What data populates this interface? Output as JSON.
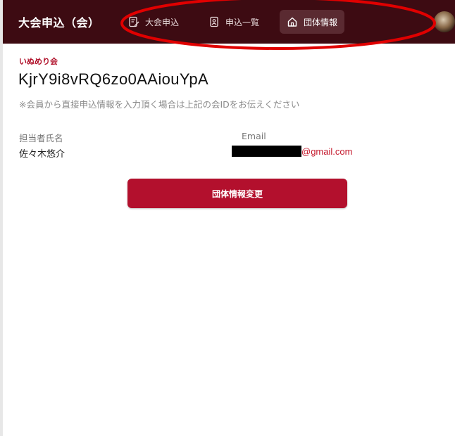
{
  "header": {
    "app_title": "大会申込（会）",
    "nav": [
      {
        "label": "大会申込",
        "icon": "edit-document-icon"
      },
      {
        "label": "申込一覧",
        "icon": "contact-list-icon"
      },
      {
        "label": "団体情報",
        "icon": "home-icon",
        "active": true
      }
    ],
    "avatar_icon": "user-avatar-icon"
  },
  "group": {
    "name": "いぬめり会",
    "id": "KjrY9i8vRQ6zo0AAiouYpA",
    "note": "※会員から直接申込情報を入力頂く場合は上記の会IDをお伝えください"
  },
  "contact": {
    "person_label": "担当者氏名",
    "person_value": "佐々木悠介",
    "email_label": "Email",
    "email_domain": "@gmail.com"
  },
  "actions": {
    "edit_button_label": "団体情報変更"
  },
  "colors": {
    "header_bg": "#3d0b12",
    "accent": "#b3102d",
    "annotation": "#e00000"
  }
}
